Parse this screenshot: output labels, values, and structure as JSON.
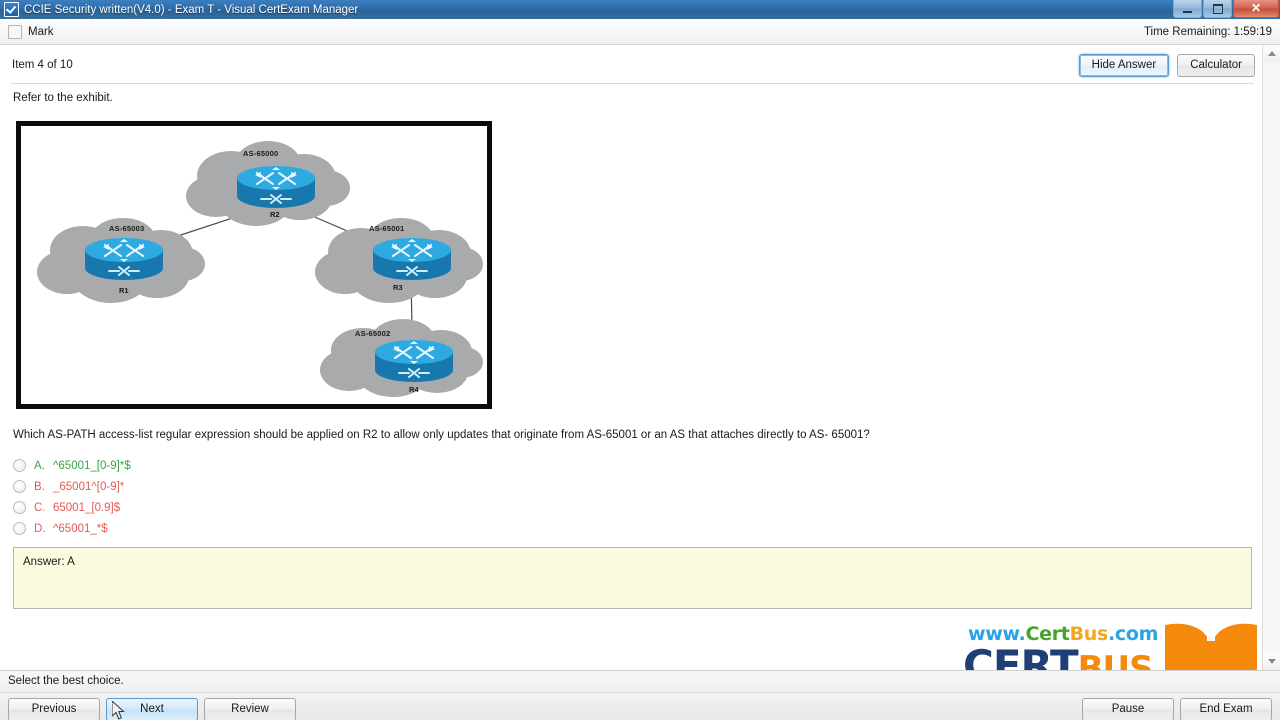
{
  "window": {
    "title": "CCIE Security written(V4.0) - Exam T - Visual CertExam Manager",
    "icon": "checkbox-app-icon",
    "minimize_label": "",
    "maximize_label": "",
    "close_label": "✕"
  },
  "markbar": {
    "mark_label": "Mark",
    "time_label": "Time Remaining:  1:59:19"
  },
  "header": {
    "item_label": "Item 4 of 10",
    "hide_answer_label": "Hide Answer",
    "calculator_label": "Calculator"
  },
  "body": {
    "refer_label": "Refer to the exhibit.",
    "question": "Which AS-PATH access-list regular expression should be applied on R2 to allow only updates that originate from AS-65001 or an AS that attaches directly to AS- 65001?"
  },
  "exhibit": {
    "nodes": [
      {
        "as": "AS-65000",
        "router": "R2"
      },
      {
        "as": "AS-65003",
        "router": "R1"
      },
      {
        "as": "AS-65001",
        "router": "R3"
      },
      {
        "as": "AS-65002",
        "router": "R4"
      }
    ],
    "links": [
      {
        "from": "R2",
        "to": "R1"
      },
      {
        "from": "R2",
        "to": "R3"
      },
      {
        "from": "R3",
        "to": "R4"
      }
    ],
    "colors": {
      "cloud": "#a9aaab",
      "router_top": "#2eaae1",
      "router_body": "#1878ad",
      "border": "#0b0b0b"
    }
  },
  "options": [
    {
      "letter": "A.",
      "text": "^65001_[0-9]*$",
      "state": "correct"
    },
    {
      "letter": "B.",
      "text": "_65001^[0-9]*",
      "state": "wrong"
    },
    {
      "letter": "C.",
      "text": "65001_[0.9]$",
      "state": "wrong"
    },
    {
      "letter": "D.",
      "text": "^65001_*$",
      "state": "wrong"
    }
  ],
  "answer": {
    "text": "Answer: A",
    "background": "#fbfbdf"
  },
  "logo": {
    "url_www": "www.",
    "url_cert": "Cert",
    "url_bus": "Bus",
    "url_com": ".com",
    "main_cert": "CERT",
    "main_bus": "BUS",
    "colors": {
      "blue": "#2aa3e0",
      "green": "#41a629",
      "orange": "#f0a81e",
      "navy": "#1f3f77",
      "mark_orange": "#f5890c"
    }
  },
  "status": {
    "text": "Select the best choice."
  },
  "toolbar": {
    "previous_label": "Previous",
    "next_label": "Next",
    "review_label": "Review",
    "pause_label": "Pause",
    "end_exam_label": "End Exam"
  }
}
